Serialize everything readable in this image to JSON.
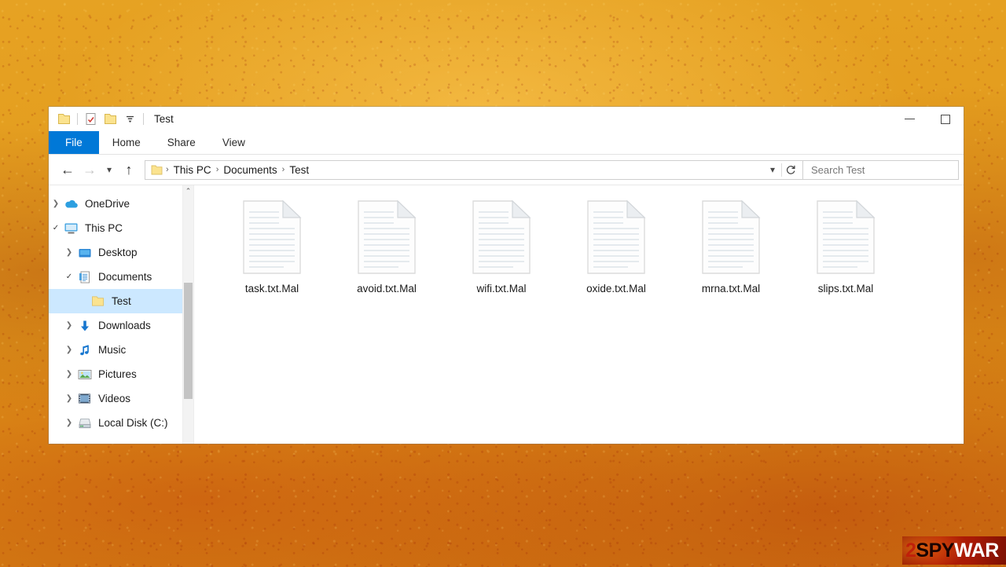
{
  "window": {
    "title": "Test",
    "quick_access": [
      {
        "name": "folder-icon",
        "label": "Folder"
      },
      {
        "name": "properties-icon",
        "label": "Properties"
      },
      {
        "name": "new-folder-icon",
        "label": "New folder"
      },
      {
        "name": "chevron-down-icon",
        "label": "Customize Quick Access Toolbar"
      }
    ],
    "controls": {
      "minimize": "Minimize",
      "maximize": "Maximize"
    }
  },
  "ribbon": {
    "tabs": [
      {
        "label": "File",
        "active": true
      },
      {
        "label": "Home",
        "active": false
      },
      {
        "label": "Share",
        "active": false
      },
      {
        "label": "View",
        "active": false
      }
    ]
  },
  "navigation": {
    "back": "Back",
    "forward": "Forward",
    "recent": "Recent locations",
    "up": "Up one level",
    "breadcrumbs": [
      "This PC",
      "Documents",
      "Test"
    ],
    "separator": "›",
    "dropdown": "Previous locations",
    "refresh": "Refresh"
  },
  "search": {
    "placeholder": "Search Test",
    "value": ""
  },
  "sidebar": {
    "items": [
      {
        "label": "OneDrive",
        "icon": "onedrive-icon",
        "indent": 0,
        "chevron": "collapsed",
        "selected": false
      },
      {
        "label": "This PC",
        "icon": "this-pc-icon",
        "indent": 0,
        "chevron": "expanded",
        "selected": false
      },
      {
        "label": "Desktop",
        "icon": "desktop-icon",
        "indent": 1,
        "chevron": "collapsed",
        "selected": false
      },
      {
        "label": "Documents",
        "icon": "documents-icon",
        "indent": 1,
        "chevron": "expanded",
        "selected": false
      },
      {
        "label": "Test",
        "icon": "folder-icon",
        "indent": 2,
        "chevron": "none",
        "selected": true
      },
      {
        "label": "Downloads",
        "icon": "downloads-icon",
        "indent": 1,
        "chevron": "collapsed",
        "selected": false
      },
      {
        "label": "Music",
        "icon": "music-icon",
        "indent": 1,
        "chevron": "collapsed",
        "selected": false
      },
      {
        "label": "Pictures",
        "icon": "pictures-icon",
        "indent": 1,
        "chevron": "collapsed",
        "selected": false
      },
      {
        "label": "Videos",
        "icon": "videos-icon",
        "indent": 1,
        "chevron": "collapsed",
        "selected": false
      },
      {
        "label": "Local Disk (C:)",
        "icon": "local-disk-icon",
        "indent": 1,
        "chevron": "collapsed",
        "selected": false
      }
    ],
    "scroll_up": "⌃"
  },
  "files": [
    {
      "name": "task.txt.Mal",
      "icon": "text-document-icon"
    },
    {
      "name": "avoid.txt.Mal",
      "icon": "text-document-icon"
    },
    {
      "name": "wifi.txt.Mal",
      "icon": "text-document-icon"
    },
    {
      "name": "oxide.txt.Mal",
      "icon": "text-document-icon"
    },
    {
      "name": "mrna.txt.Mal",
      "icon": "text-document-icon"
    },
    {
      "name": "slips.txt.Mal",
      "icon": "text-document-icon"
    }
  ],
  "watermark": {
    "prefix": "2",
    "mid": "SPY",
    "suffix": "WAR"
  },
  "colors": {
    "accent": "#0078d7",
    "selection": "#cce8ff",
    "folder": "#fbe38f",
    "desktop_bg": "#e09b1e",
    "watermark_red": "#b31c06"
  }
}
